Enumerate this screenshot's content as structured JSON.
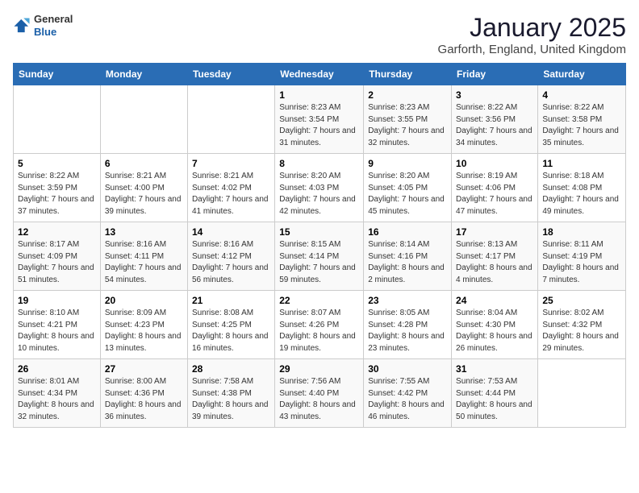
{
  "header": {
    "logo_general": "General",
    "logo_blue": "Blue",
    "month": "January 2025",
    "location": "Garforth, England, United Kingdom"
  },
  "weekdays": [
    "Sunday",
    "Monday",
    "Tuesday",
    "Wednesday",
    "Thursday",
    "Friday",
    "Saturday"
  ],
  "weeks": [
    [
      {
        "day": "",
        "sunrise": "",
        "sunset": "",
        "daylight": ""
      },
      {
        "day": "",
        "sunrise": "",
        "sunset": "",
        "daylight": ""
      },
      {
        "day": "",
        "sunrise": "",
        "sunset": "",
        "daylight": ""
      },
      {
        "day": "1",
        "sunrise": "Sunrise: 8:23 AM",
        "sunset": "Sunset: 3:54 PM",
        "daylight": "Daylight: 7 hours and 31 minutes."
      },
      {
        "day": "2",
        "sunrise": "Sunrise: 8:23 AM",
        "sunset": "Sunset: 3:55 PM",
        "daylight": "Daylight: 7 hours and 32 minutes."
      },
      {
        "day": "3",
        "sunrise": "Sunrise: 8:22 AM",
        "sunset": "Sunset: 3:56 PM",
        "daylight": "Daylight: 7 hours and 34 minutes."
      },
      {
        "day": "4",
        "sunrise": "Sunrise: 8:22 AM",
        "sunset": "Sunset: 3:58 PM",
        "daylight": "Daylight: 7 hours and 35 minutes."
      }
    ],
    [
      {
        "day": "5",
        "sunrise": "Sunrise: 8:22 AM",
        "sunset": "Sunset: 3:59 PM",
        "daylight": "Daylight: 7 hours and 37 minutes."
      },
      {
        "day": "6",
        "sunrise": "Sunrise: 8:21 AM",
        "sunset": "Sunset: 4:00 PM",
        "daylight": "Daylight: 7 hours and 39 minutes."
      },
      {
        "day": "7",
        "sunrise": "Sunrise: 8:21 AM",
        "sunset": "Sunset: 4:02 PM",
        "daylight": "Daylight: 7 hours and 41 minutes."
      },
      {
        "day": "8",
        "sunrise": "Sunrise: 8:20 AM",
        "sunset": "Sunset: 4:03 PM",
        "daylight": "Daylight: 7 hours and 42 minutes."
      },
      {
        "day": "9",
        "sunrise": "Sunrise: 8:20 AM",
        "sunset": "Sunset: 4:05 PM",
        "daylight": "Daylight: 7 hours and 45 minutes."
      },
      {
        "day": "10",
        "sunrise": "Sunrise: 8:19 AM",
        "sunset": "Sunset: 4:06 PM",
        "daylight": "Daylight: 7 hours and 47 minutes."
      },
      {
        "day": "11",
        "sunrise": "Sunrise: 8:18 AM",
        "sunset": "Sunset: 4:08 PM",
        "daylight": "Daylight: 7 hours and 49 minutes."
      }
    ],
    [
      {
        "day": "12",
        "sunrise": "Sunrise: 8:17 AM",
        "sunset": "Sunset: 4:09 PM",
        "daylight": "Daylight: 7 hours and 51 minutes."
      },
      {
        "day": "13",
        "sunrise": "Sunrise: 8:16 AM",
        "sunset": "Sunset: 4:11 PM",
        "daylight": "Daylight: 7 hours and 54 minutes."
      },
      {
        "day": "14",
        "sunrise": "Sunrise: 8:16 AM",
        "sunset": "Sunset: 4:12 PM",
        "daylight": "Daylight: 7 hours and 56 minutes."
      },
      {
        "day": "15",
        "sunrise": "Sunrise: 8:15 AM",
        "sunset": "Sunset: 4:14 PM",
        "daylight": "Daylight: 7 hours and 59 minutes."
      },
      {
        "day": "16",
        "sunrise": "Sunrise: 8:14 AM",
        "sunset": "Sunset: 4:16 PM",
        "daylight": "Daylight: 8 hours and 2 minutes."
      },
      {
        "day": "17",
        "sunrise": "Sunrise: 8:13 AM",
        "sunset": "Sunset: 4:17 PM",
        "daylight": "Daylight: 8 hours and 4 minutes."
      },
      {
        "day": "18",
        "sunrise": "Sunrise: 8:11 AM",
        "sunset": "Sunset: 4:19 PM",
        "daylight": "Daylight: 8 hours and 7 minutes."
      }
    ],
    [
      {
        "day": "19",
        "sunrise": "Sunrise: 8:10 AM",
        "sunset": "Sunset: 4:21 PM",
        "daylight": "Daylight: 8 hours and 10 minutes."
      },
      {
        "day": "20",
        "sunrise": "Sunrise: 8:09 AM",
        "sunset": "Sunset: 4:23 PM",
        "daylight": "Daylight: 8 hours and 13 minutes."
      },
      {
        "day": "21",
        "sunrise": "Sunrise: 8:08 AM",
        "sunset": "Sunset: 4:25 PM",
        "daylight": "Daylight: 8 hours and 16 minutes."
      },
      {
        "day": "22",
        "sunrise": "Sunrise: 8:07 AM",
        "sunset": "Sunset: 4:26 PM",
        "daylight": "Daylight: 8 hours and 19 minutes."
      },
      {
        "day": "23",
        "sunrise": "Sunrise: 8:05 AM",
        "sunset": "Sunset: 4:28 PM",
        "daylight": "Daylight: 8 hours and 23 minutes."
      },
      {
        "day": "24",
        "sunrise": "Sunrise: 8:04 AM",
        "sunset": "Sunset: 4:30 PM",
        "daylight": "Daylight: 8 hours and 26 minutes."
      },
      {
        "day": "25",
        "sunrise": "Sunrise: 8:02 AM",
        "sunset": "Sunset: 4:32 PM",
        "daylight": "Daylight: 8 hours and 29 minutes."
      }
    ],
    [
      {
        "day": "26",
        "sunrise": "Sunrise: 8:01 AM",
        "sunset": "Sunset: 4:34 PM",
        "daylight": "Daylight: 8 hours and 32 minutes."
      },
      {
        "day": "27",
        "sunrise": "Sunrise: 8:00 AM",
        "sunset": "Sunset: 4:36 PM",
        "daylight": "Daylight: 8 hours and 36 minutes."
      },
      {
        "day": "28",
        "sunrise": "Sunrise: 7:58 AM",
        "sunset": "Sunset: 4:38 PM",
        "daylight": "Daylight: 8 hours and 39 minutes."
      },
      {
        "day": "29",
        "sunrise": "Sunrise: 7:56 AM",
        "sunset": "Sunset: 4:40 PM",
        "daylight": "Daylight: 8 hours and 43 minutes."
      },
      {
        "day": "30",
        "sunrise": "Sunrise: 7:55 AM",
        "sunset": "Sunset: 4:42 PM",
        "daylight": "Daylight: 8 hours and 46 minutes."
      },
      {
        "day": "31",
        "sunrise": "Sunrise: 7:53 AM",
        "sunset": "Sunset: 4:44 PM",
        "daylight": "Daylight: 8 hours and 50 minutes."
      },
      {
        "day": "",
        "sunrise": "",
        "sunset": "",
        "daylight": ""
      }
    ]
  ]
}
